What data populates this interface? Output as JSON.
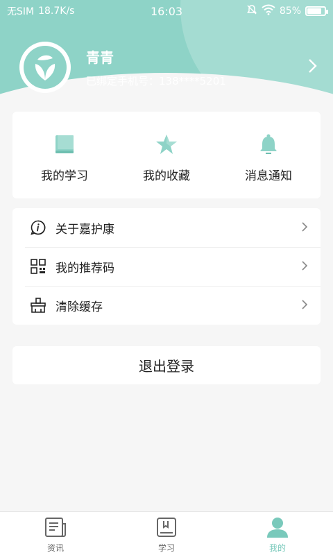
{
  "status_bar": {
    "carrier": "无SIM",
    "speed": "18.7K/s",
    "time": "16:03",
    "battery": "85%",
    "battery_level": 0.85
  },
  "profile": {
    "name": "青青",
    "phone_label": "已绑定手机号：138****5201"
  },
  "quick_actions": [
    {
      "label": "我的学习",
      "icon": "book-icon"
    },
    {
      "label": "我的收藏",
      "icon": "star-icon"
    },
    {
      "label": "消息通知",
      "icon": "bell-icon"
    }
  ],
  "settings": [
    {
      "label": "关于嘉护康",
      "icon": "info-icon"
    },
    {
      "label": "我的推荐码",
      "icon": "qr-code-icon"
    },
    {
      "label": "清除缓存",
      "icon": "broom-icon"
    }
  ],
  "logout_label": "退出登录",
  "tabs": [
    {
      "label": "资讯",
      "icon": "news-icon",
      "active": false
    },
    {
      "label": "学习",
      "icon": "study-book-icon",
      "active": false
    },
    {
      "label": "我的",
      "icon": "person-icon",
      "active": true
    }
  ],
  "colors": {
    "accent": "#8ed3c7",
    "accent_dark": "#79c9bb",
    "background": "#f6f6f6"
  }
}
